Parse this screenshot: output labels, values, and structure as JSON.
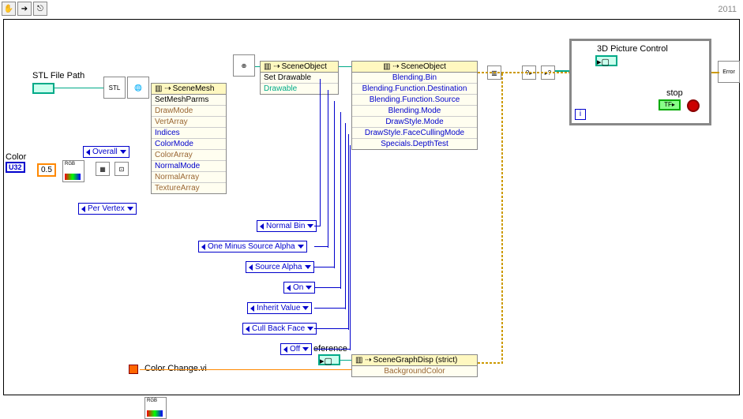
{
  "toolbar": {
    "hand": "✋",
    "arrow": "➔",
    "spool": "⎋"
  },
  "version": "2011",
  "labels": {
    "stl": "STL File Path",
    "color": "Color",
    "colorchange": "Color Change.vi",
    "reference": "eference",
    "picture": "3D Picture Control",
    "stop": "stop"
  },
  "terminals": {
    "u32": "U32",
    "half": "0.5",
    "err": "Error"
  },
  "consts": {
    "overall": "Overall",
    "pervertex": "Per Vertex",
    "normalbin": "Normal Bin",
    "ominussrc": "One Minus Source Alpha",
    "srcalpha": "Source Alpha",
    "on": "On",
    "inherit": "Inherit Value",
    "cullback": "Cull Back Face",
    "off": "Off"
  },
  "mesh": {
    "header": "SceneMesh",
    "rows": [
      "SetMeshParms",
      "DrawMode",
      "VertArray",
      "Indices",
      "ColorMode",
      "ColorArray",
      "NormalMode",
      "NormalArray",
      "TextureArray"
    ]
  },
  "sceneobj1": {
    "header": "SceneObject",
    "rows": [
      "Set Drawable",
      "Drawable"
    ]
  },
  "sceneobj2": {
    "header": "SceneObject",
    "rows": [
      "Blending.Bin",
      "Blending.Function.Destination",
      "Blending.Function.Source",
      "Blending.Mode",
      "DrawStyle.Mode",
      "DrawStyle.FaceCullingMode",
      "Specials.DepthTest"
    ]
  },
  "graphdisp": {
    "header": "SceneGraphDisp (strict)",
    "rows": [
      "BackgroundColor"
    ]
  }
}
